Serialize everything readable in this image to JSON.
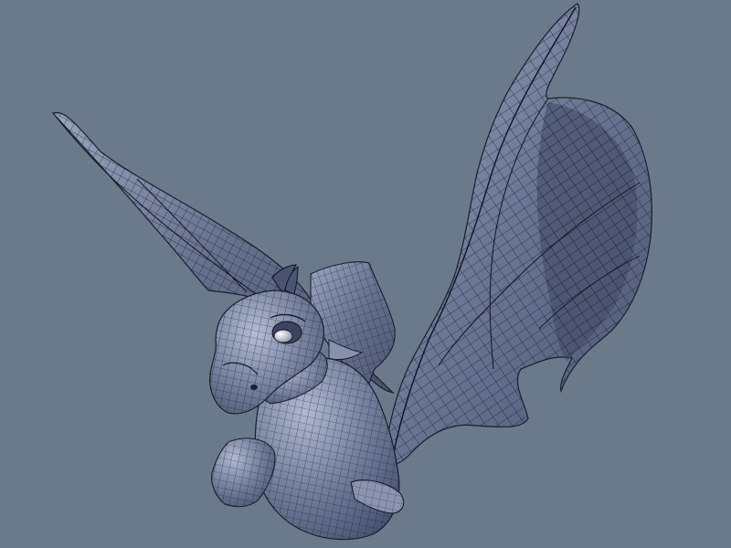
{
  "viewport": {
    "background_color": "#6b7a8a",
    "model_fill_color": "#6d7995",
    "model_shade_color": "#4d5670",
    "model_highlight_color": "#aab3cc",
    "wire_color": "#101320",
    "eye_color": "#c4c7cf"
  },
  "model": {
    "icon": "wireframe-dragon-model"
  }
}
